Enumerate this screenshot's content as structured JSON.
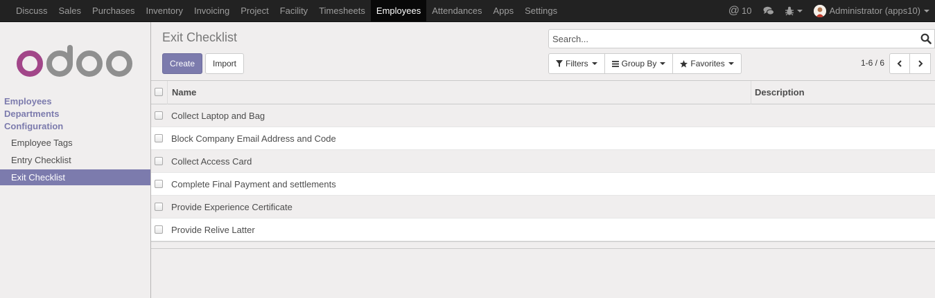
{
  "topbar": {
    "menu": [
      {
        "label": "Discuss",
        "active": false
      },
      {
        "label": "Sales",
        "active": false
      },
      {
        "label": "Purchases",
        "active": false
      },
      {
        "label": "Inventory",
        "active": false
      },
      {
        "label": "Invoicing",
        "active": false
      },
      {
        "label": "Project",
        "active": false
      },
      {
        "label": "Facility",
        "active": false
      },
      {
        "label": "Timesheets",
        "active": false
      },
      {
        "label": "Employees",
        "active": true
      },
      {
        "label": "Attendances",
        "active": false
      },
      {
        "label": "Apps",
        "active": false
      },
      {
        "label": "Settings",
        "active": false
      }
    ],
    "mentions_count": "10",
    "user": "Administrator (apps10)"
  },
  "sidebar": {
    "sections": [
      "Employees",
      "Departments",
      "Configuration"
    ],
    "items": [
      {
        "label": "Employee Tags",
        "active": false
      },
      {
        "label": "Entry Checklist",
        "active": false
      },
      {
        "label": "Exit Checklist",
        "active": true
      }
    ]
  },
  "control_panel": {
    "title": "Exit Checklist",
    "create_label": "Create",
    "import_label": "Import",
    "search_placeholder": "Search...",
    "filters_label": "Filters",
    "group_by_label": "Group By",
    "favorites_label": "Favorites",
    "pager": "1-6 / 6"
  },
  "table": {
    "columns": [
      "Name",
      "Description"
    ],
    "rows": [
      "Collect Laptop and Bag",
      "Block Company Email Address and Code",
      "Collect Access Card",
      "Complete Final Payment and settlements",
      "Provide Experience Certificate",
      "Provide Relive Latter"
    ]
  },
  "colors": {
    "brand": "#7c7bad",
    "navbar": "#222222",
    "logo_purple": "#a24689",
    "logo_grey": "#8f8f8f"
  }
}
